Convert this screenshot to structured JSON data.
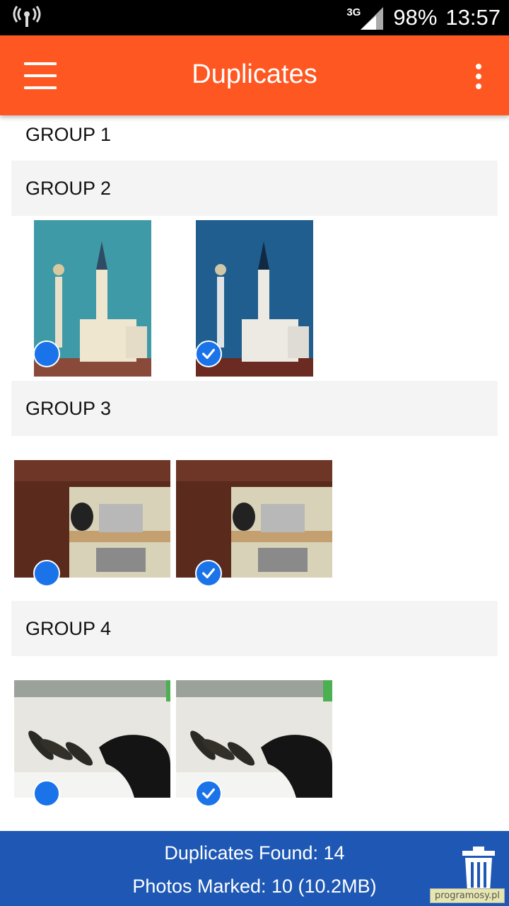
{
  "status_bar": {
    "network": "3G",
    "battery": "98%",
    "time": "13:57"
  },
  "app_bar": {
    "title": "Duplicates",
    "menu_icon": "hamburger-menu-icon",
    "overflow_icon": "more-vert-icon",
    "color": "#ff5722"
  },
  "groups": [
    {
      "label": "GROUP 1"
    },
    {
      "label": "GROUP 2"
    },
    {
      "label": "GROUP 3"
    },
    {
      "label": "GROUP 4"
    }
  ],
  "photos": {
    "group2": [
      {
        "selected": false
      },
      {
        "selected": true
      }
    ],
    "group3": [
      {
        "selected": false
      },
      {
        "selected": true
      }
    ],
    "group4": [
      {
        "selected": false
      },
      {
        "selected": true
      }
    ]
  },
  "bottom_bar": {
    "duplicates_found": "Duplicates Found: 14",
    "photos_marked": "Photos Marked: 10 (10.2MB)",
    "delete_icon": "trash-icon",
    "color": "#1e58b4"
  },
  "watermark": "programosy.pl"
}
